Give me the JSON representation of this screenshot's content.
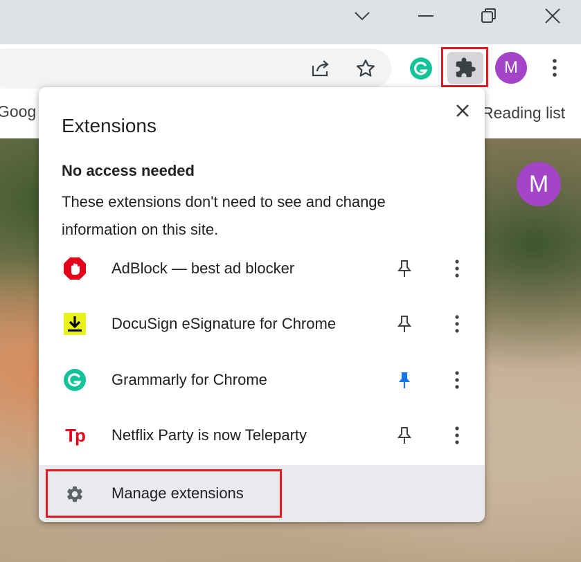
{
  "bookmarks": {
    "left_item": "Goog",
    "reading_list": "Reading list"
  },
  "profile": {
    "initial": "M",
    "color": "#a445c7"
  },
  "extensions_popup": {
    "title": "Extensions",
    "section_heading": "No access needed",
    "section_description": "These extensions don't need to see and change information on this site.",
    "items": [
      {
        "name": "AdBlock — best ad blocker",
        "icon": "adblock-icon",
        "pinned": false
      },
      {
        "name": "DocuSign eSignature for Chrome",
        "icon": "docusign-icon",
        "pinned": false
      },
      {
        "name": "Grammarly for Chrome",
        "icon": "grammarly-icon",
        "pinned": true
      },
      {
        "name": "Netflix Party is now Teleparty",
        "icon": "teleparty-icon",
        "pinned": false
      }
    ],
    "manage_label": "Manage extensions",
    "teleparty_logo_text": "Tp"
  },
  "colors": {
    "highlight": "#e01b22",
    "pinned": "#1a73e8",
    "grammarly": "#15c39a",
    "adblock": "#e3001b",
    "docusign": "#e7f21a"
  }
}
